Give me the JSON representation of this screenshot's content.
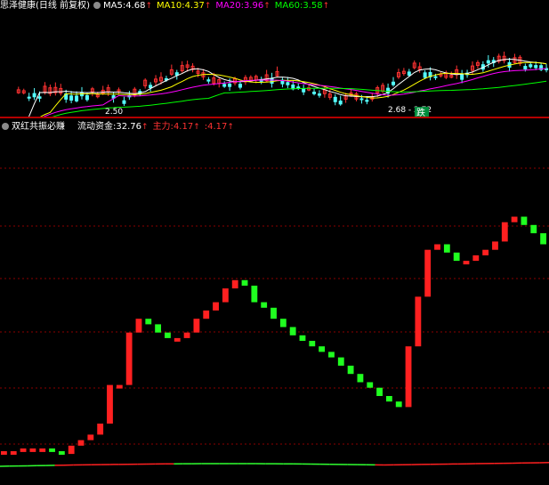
{
  "main_panel": {
    "stock_title": "思泽健康(日线 前复权)",
    "indicators": [
      {
        "name": "MA5",
        "value": "4.68",
        "color": "#ffffff"
      },
      {
        "name": "MA10",
        "value": "4.37",
        "color": "#ffff00"
      },
      {
        "name": "MA20",
        "value": "3.96",
        "color": "#ff00ff"
      },
      {
        "name": "MA60",
        "value": "3.58",
        "color": "#00ff00"
      }
    ],
    "up_arrow": "↑",
    "low_label": "2.50",
    "range_label": "2.68 - 2.72",
    "signal_label": "跌",
    "colors": {
      "up": "#ff3232",
      "down": "#54ffff",
      "ma5": "#ffffff",
      "ma10": "#ffff00",
      "ma20": "#ff00ff",
      "ma60": "#00ff00"
    }
  },
  "sub_panel": {
    "title": "双红共振必赚",
    "indicators": [
      {
        "name": "流动资金",
        "value": "32.76",
        "color": "#ffffff"
      },
      {
        "name": "主力",
        "value": "4.17",
        "color": "#ff3232"
      },
      {
        "name": "",
        "value": "4.17",
        "color": "#ff3232"
      }
    ],
    "up_arrow": "↑",
    "colors": {
      "up": "#ff2020",
      "down": "#20ff20",
      "grid": "#8b0000",
      "base_up": "#ff2020",
      "base_down": "#30ff30"
    }
  },
  "chart_data": {
    "type": "bar",
    "series": [
      {
        "name": "流动资金",
        "values": [
          10,
          10,
          11,
          11,
          11,
          10,
          9,
          12,
          14,
          16,
          20,
          34,
          34,
          53,
          58,
          56,
          53,
          51,
          51,
          53,
          58,
          61,
          64,
          69,
          72,
          70,
          64,
          62,
          58,
          55,
          52,
          50,
          48,
          46,
          44,
          41,
          38,
          35,
          33,
          30,
          28,
          26,
          48,
          66,
          83,
          85,
          82,
          79,
          79,
          81,
          83,
          86,
          93,
          95,
          92,
          89,
          85
        ]
      }
    ],
    "grid": true
  }
}
